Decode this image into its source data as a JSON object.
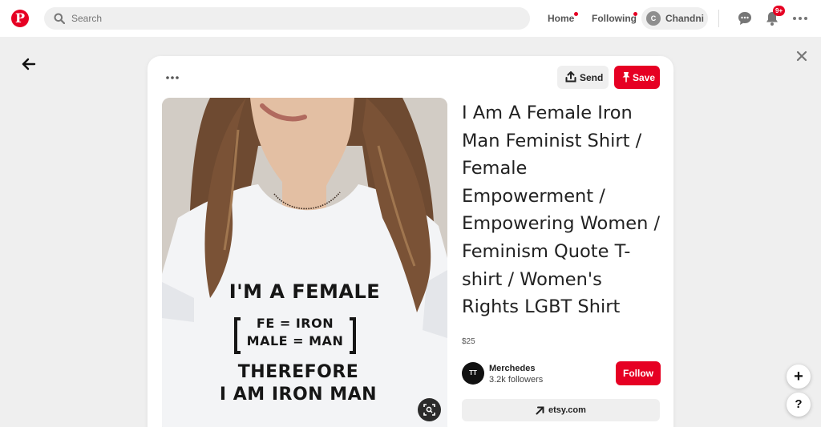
{
  "header": {
    "logo_letter": "P",
    "search_placeholder": "Search",
    "nav_home": "Home",
    "nav_following": "Following",
    "profile_initial": "C",
    "profile_name": "Chandni",
    "notification_count": "9+"
  },
  "pin": {
    "title": "I Am A Female Iron Man Feminist Shirt / Female Empowerment / Empowering Women / Feminism Quote T-shirt / Women's Rights LGBT Shirt",
    "price": "$25",
    "send_label": "Send",
    "save_label": "Save",
    "link_label": "etsy.com",
    "shirt_lines": [
      "I'M A FEMALE",
      "FE = IRON",
      "MALE = MAN",
      "THEREFORE",
      "I AM IRON MAN"
    ]
  },
  "creator": {
    "name": "Merchedes",
    "followers": "3.2k followers",
    "follow_label": "Follow",
    "avatar_text": "TT"
  },
  "fab": {
    "plus": "+",
    "help": "?"
  },
  "colors": {
    "brand_red": "#e60023",
    "background": "#efefef",
    "button_grey": "#efefef"
  }
}
